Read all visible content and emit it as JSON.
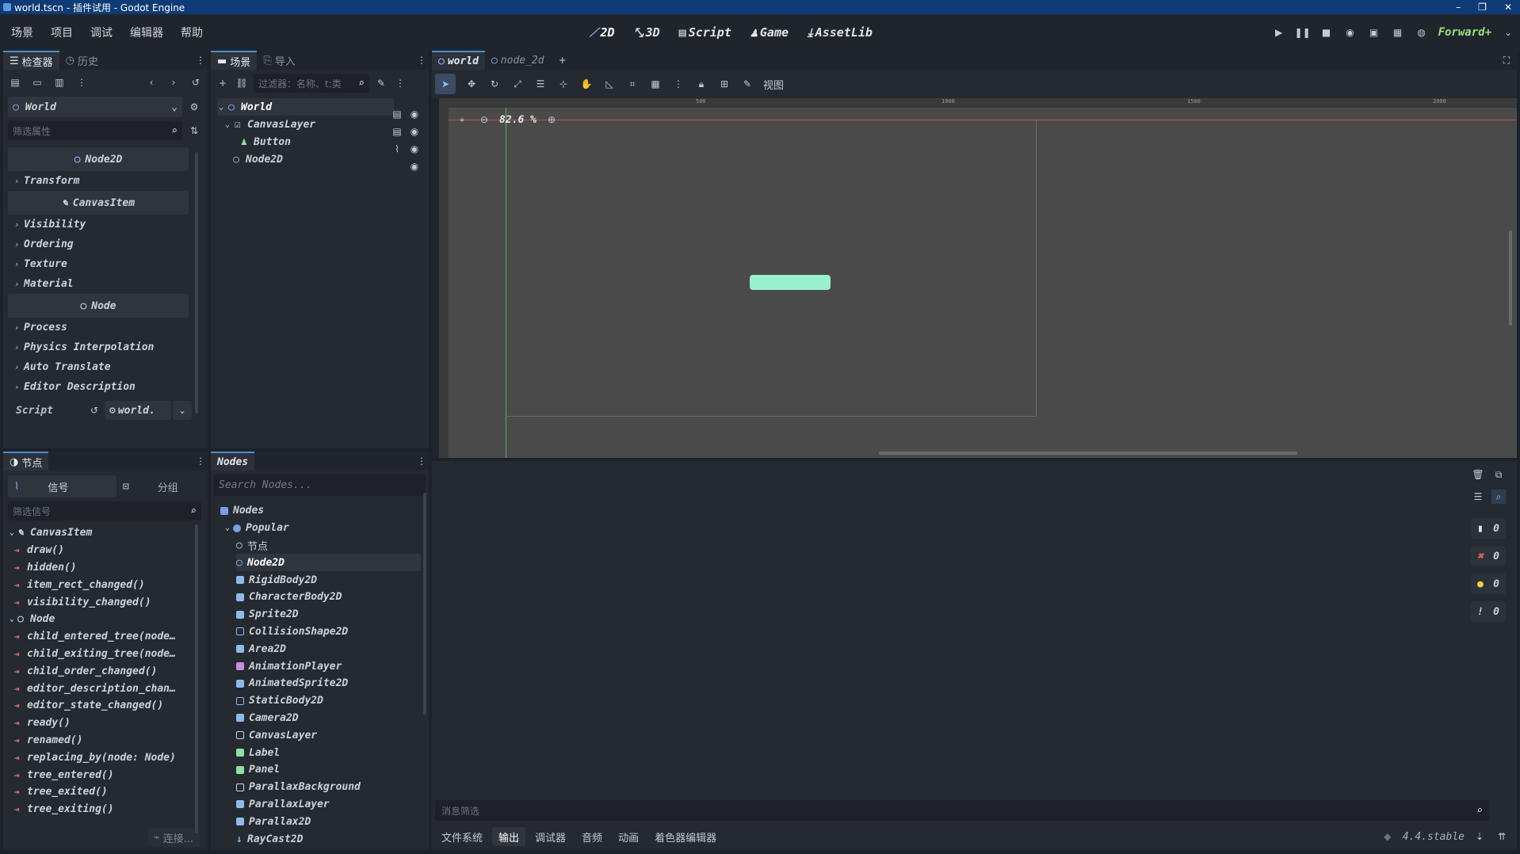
{
  "window": {
    "title": "world.tscn - 插件试用 - Godot Engine",
    "controls": [
      "–",
      "❐",
      "✕"
    ]
  },
  "menu": [
    "场景",
    "项目",
    "调试",
    "编辑器",
    "帮助"
  ],
  "workspaces": [
    "2D",
    "3D",
    "Script",
    "Game",
    "AssetLib"
  ],
  "renderer": "Forward+",
  "inspector": {
    "tabs": [
      "检查器",
      "历史"
    ],
    "object": "World",
    "filter_placeholder": "筛选属性",
    "sections": [
      {
        "header": "Node2D",
        "cats": [
          "Transform"
        ]
      },
      {
        "header": "CanvasItem",
        "cats": [
          "Visibility",
          "Ordering",
          "Texture",
          "Material"
        ]
      },
      {
        "header": "Node",
        "cats": [
          "Process",
          "Physics Interpolation",
          "Auto Translate",
          "Editor Description"
        ]
      }
    ],
    "script_label": "Script",
    "script_value": "world."
  },
  "signals": {
    "tab": "节点",
    "subtabs": [
      "信号",
      "分组"
    ],
    "filter_placeholder": "筛选信号",
    "groups": [
      {
        "name": "CanvasItem",
        "items": [
          "draw()",
          "hidden()",
          "item_rect_changed()",
          "visibility_changed()"
        ]
      },
      {
        "name": "Node",
        "items": [
          "child_entered_tree(node…",
          "child_exiting_tree(node…",
          "child_order_changed()",
          "editor_description_chan…",
          "editor_state_changed()",
          "ready()",
          "renamed()",
          "replacing_by(node: Node)",
          "tree_entered()",
          "tree_exited()",
          "tree_exiting()"
        ]
      }
    ],
    "connect_label": "连接..."
  },
  "scene": {
    "tabs": [
      "场景",
      "导入"
    ],
    "filter_placeholder": "过滤器：名称、t:类",
    "tree": [
      {
        "name": "World",
        "depth": 0,
        "icon": "circle",
        "color": "#8fb8f0"
      },
      {
        "name": "CanvasLayer",
        "depth": 1,
        "icon": "canvas",
        "color": "#d0d4da"
      },
      {
        "name": "Button",
        "depth": 2,
        "icon": "button",
        "color": "#8fe0a0"
      },
      {
        "name": "Node2D",
        "depth": 1,
        "icon": "circle",
        "color": "#8fb8f0"
      }
    ]
  },
  "nodes_panel": {
    "title": "Nodes",
    "search_placeholder": "Search Nodes...",
    "root": "Nodes",
    "group": "Popular",
    "items": [
      {
        "name": "节点",
        "color": "#d0d4da",
        "icon": "circle"
      },
      {
        "name": "Node2D",
        "color": "#8fb8f0",
        "icon": "circle"
      },
      {
        "name": "RigidBody2D",
        "color": "#8fb8f0",
        "icon": "sq"
      },
      {
        "name": "CharacterBody2D",
        "color": "#8fb8f0",
        "icon": "sq"
      },
      {
        "name": "Sprite2D",
        "color": "#8fb8f0",
        "icon": "sq"
      },
      {
        "name": "CollisionShape2D",
        "color": "#8fb8f0",
        "icon": "outline"
      },
      {
        "name": "Area2D",
        "color": "#8fb8f0",
        "icon": "sq"
      },
      {
        "name": "AnimationPlayer",
        "color": "#c48ee8",
        "icon": "sq"
      },
      {
        "name": "AnimatedSprite2D",
        "color": "#8fb8f0",
        "icon": "sq"
      },
      {
        "name": "StaticBody2D",
        "color": "#8fb8f0",
        "icon": "outline"
      },
      {
        "name": "Camera2D",
        "color": "#8fb8f0",
        "icon": "sq"
      },
      {
        "name": "CanvasLayer",
        "color": "#d0d4da",
        "icon": "outline"
      },
      {
        "name": "Label",
        "color": "#8fe0a0",
        "icon": "sq"
      },
      {
        "name": "Panel",
        "color": "#8fe0a0",
        "icon": "sq"
      },
      {
        "name": "ParallaxBackground",
        "color": "#d0d4da",
        "icon": "outline"
      },
      {
        "name": "ParallaxLayer",
        "color": "#8fb8f0",
        "icon": "sq"
      },
      {
        "name": "Parallax2D",
        "color": "#8fb8f0",
        "icon": "sq"
      },
      {
        "name": "RayCast2D",
        "color": "#8fb8f0",
        "icon": "arrow"
      }
    ]
  },
  "editor": {
    "tabs": [
      "world",
      "node_2d"
    ],
    "view_label": "视图",
    "zoom": "82.6 %",
    "ruler_marks": [
      "500",
      "1000",
      "1500",
      "2000"
    ]
  },
  "output": {
    "filter_placeholder": "消息筛选",
    "counts": [
      "0",
      "0",
      "0",
      "0"
    ],
    "bottom_tabs": [
      "文件系统",
      "输出",
      "调试器",
      "音频",
      "动画",
      "着色器编辑器"
    ],
    "version": "4.4.stable"
  }
}
